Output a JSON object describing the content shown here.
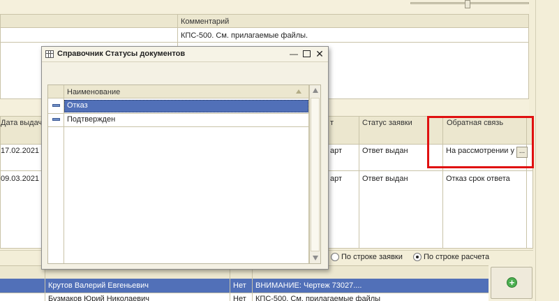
{
  "top_grid": {
    "comment_header": "Комментарий",
    "comment_value": "КПС-500. См. прилагаемые файлы."
  },
  "mid_grid": {
    "headers": [
      "Дата выдач",
      "т",
      "Статус заявки",
      "Обратная связь"
    ],
    "rows": [
      {
        "date": "17.02.2021",
        "col2": "арт",
        "status": "Ответ выдан",
        "feedback": "На рассмотрении у"
      },
      {
        "date": "09.03.2021",
        "col2": "арт",
        "status": "Ответ выдан",
        "feedback": "Отказ срок ответа"
      }
    ],
    "ellipsis": "..."
  },
  "radio": {
    "option1": "По строке заявки",
    "option2": "По строке расчета"
  },
  "bottom_grid": {
    "rows": [
      {
        "name": "Крутов Валерий Евгеньевич",
        "flag": "Нет",
        "comment": "ВНИМАНИЕ: Чертеж 73027...."
      },
      {
        "name": "Бузмаков Юрий Николаевич",
        "flag": "Нет",
        "comment": "КПС-500. См. прилагаемые файлы"
      }
    ]
  },
  "dialog": {
    "title": "Справочник Статусы документов",
    "column_header": "Наименование",
    "items": [
      "Отказ",
      "Подтвержден"
    ]
  },
  "colors": {
    "selection": "#5170b8",
    "highlight_box": "#e01010"
  }
}
